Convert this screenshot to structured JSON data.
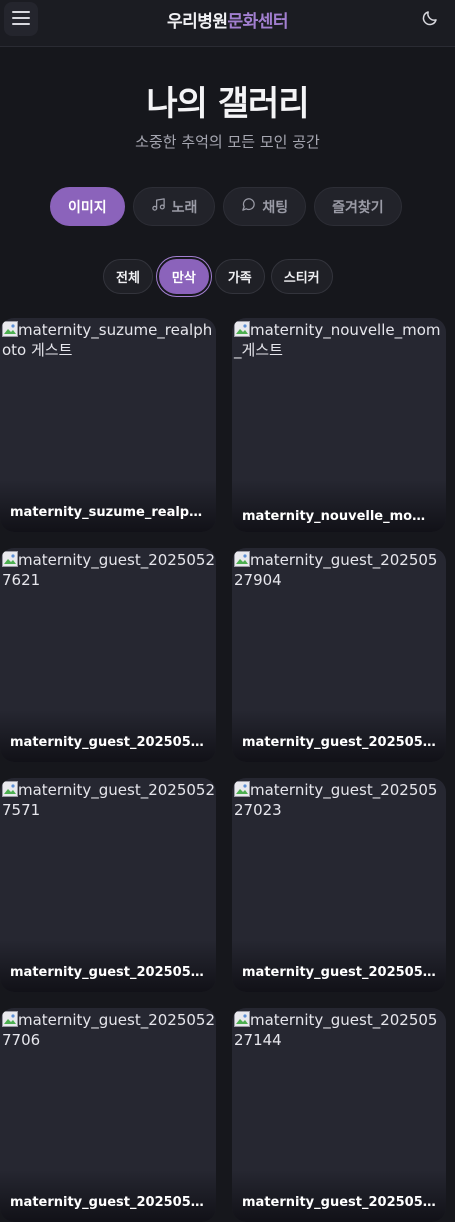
{
  "header": {
    "brand_part1": "우리병원",
    "brand_part2": "문화센터",
    "menu_icon": "hamburger-menu-icon",
    "theme_icon": "moon-icon"
  },
  "page": {
    "title": "나의 갤러리",
    "subtitle": "소중한 추억의 모든 모인 공간"
  },
  "tabs": [
    {
      "label": "이미지",
      "icon": "",
      "active": true
    },
    {
      "label": "노래",
      "icon": "music-note-icon",
      "active": false
    },
    {
      "label": "채팅",
      "icon": "chat-bubble-icon",
      "active": false
    },
    {
      "label": "즐겨찾기",
      "icon": "",
      "active": false
    }
  ],
  "filters": [
    {
      "label": "전체",
      "active": false
    },
    {
      "label": "만삭",
      "active": true
    },
    {
      "label": "가족",
      "active": false
    },
    {
      "label": "스티커",
      "active": false
    }
  ],
  "gallery": [
    {
      "alt": "maternity_suzume_realphoto 게스트",
      "caption": "maternity_suzume_realphoto"
    },
    {
      "alt": "maternity_nouvelle_mom_게스트",
      "caption": "maternity_nouvelle_mom_게스트"
    },
    {
      "alt": "maternity_guest_20250527621",
      "caption": "maternity_guest_20250527621"
    },
    {
      "alt": "maternity_guest_20250527904",
      "caption": "maternity_guest_20250527904"
    },
    {
      "alt": "maternity_guest_20250527571",
      "caption": "maternity_guest_20250527571"
    },
    {
      "alt": "maternity_guest_20250527023",
      "caption": "maternity_guest_20250527023"
    },
    {
      "alt": "maternity_guest_20250527706",
      "caption": "maternity_guest_20250527706"
    },
    {
      "alt": "maternity_guest_20250527144",
      "caption": "maternity_guest_20250527144"
    }
  ],
  "colors": {
    "accent": "#8b63bb",
    "brand_secondary": "#a27fd0",
    "background": "#16171c",
    "card": "#262731"
  }
}
